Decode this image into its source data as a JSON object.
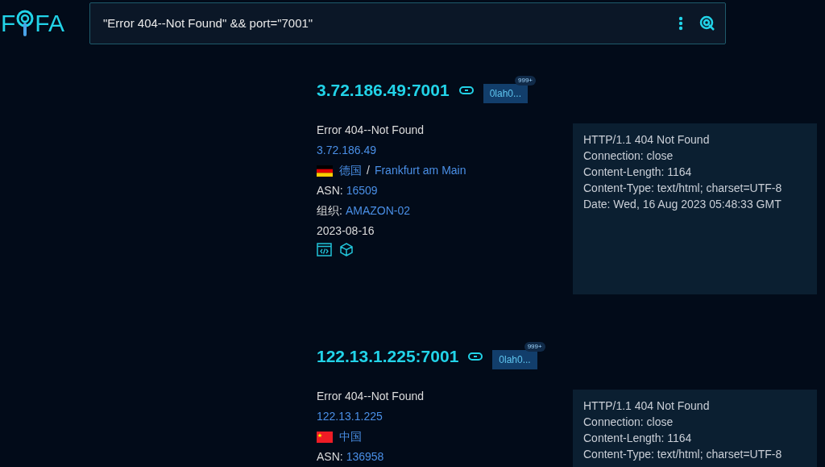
{
  "logo": {
    "before": "F",
    "after": "FA"
  },
  "search": {
    "value": "\"Error 404--Not Found\" && port=\"7001\""
  },
  "results": [
    {
      "host": "3.72.186.49:7001",
      "tag": "0lah0...",
      "tag_count": "999+",
      "title": "Error 404--Not Found",
      "ip": "3.72.186.49",
      "flag": {
        "kind": "germany"
      },
      "country": "德国",
      "separator": "/",
      "city": "Frankfurt am Main",
      "asn_label": "ASN:",
      "asn": "16509",
      "org_label": "组织:",
      "org": "AMAZON-02",
      "date": "2023-08-16",
      "tools": [
        {
          "kind": "code"
        },
        {
          "kind": "cube"
        }
      ],
      "header": [
        "HTTP/1.1 404 Not Found",
        "Connection: close",
        "Content-Length: 1164",
        "Content-Type: text/html; charset=UTF-8",
        "Date: Wed, 16 Aug 2023 05:48:33 GMT"
      ]
    },
    {
      "host": "122.13.1.225:7001",
      "tag": "0lah0...",
      "tag_count": "999+",
      "title": "Error 404--Not Found",
      "ip": "122.13.1.225",
      "flag": {
        "kind": "china"
      },
      "country": "中国",
      "asn_label": "ASN:",
      "asn": "136958",
      "header": [
        "HTTP/1.1 404 Not Found",
        "Connection: close",
        "Content-Length: 1164",
        "Content-Type: text/html; charset=UTF-8"
      ]
    }
  ]
}
